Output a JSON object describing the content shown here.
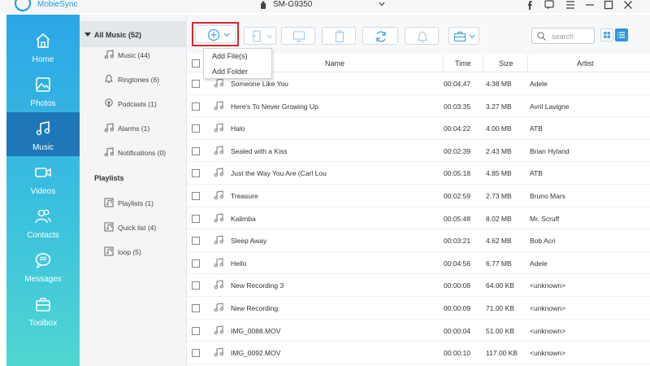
{
  "app": {
    "title": "MobieSync"
  },
  "device": {
    "name": "SM-G9350"
  },
  "colors": {
    "accent": "#1e9be0",
    "nav_active": "#1d77b8",
    "highlight": "#d9262a"
  },
  "nav": [
    {
      "label": "Home",
      "icon": "home-icon"
    },
    {
      "label": "Photos",
      "icon": "photo-icon"
    },
    {
      "label": "Music",
      "icon": "music-icon",
      "active": true
    },
    {
      "label": "Videos",
      "icon": "video-icon"
    },
    {
      "label": "Contacts",
      "icon": "contacts-icon"
    },
    {
      "label": "Messages",
      "icon": "messages-icon"
    },
    {
      "label": "Toolbox",
      "icon": "toolbox-icon"
    }
  ],
  "categories": {
    "header": "All Music (52)",
    "items": [
      {
        "label": "Music (44)",
        "icon": "music-note-icon"
      },
      {
        "label": "Ringtones (6)",
        "icon": "bell-icon"
      },
      {
        "label": "Podcasts (1)",
        "icon": "podcast-icon"
      },
      {
        "label": "Alarms (1)",
        "icon": "alarm-icon"
      },
      {
        "label": "Notifications (0)",
        "icon": "notification-icon"
      }
    ],
    "playlists_title": "Playlists",
    "playlists": [
      {
        "label": "Playlists (1)",
        "icon": "playlist-icon"
      },
      {
        "label": "Quick list (4)",
        "icon": "playlist-icon"
      },
      {
        "label": "loop (5)",
        "icon": "playlist-icon"
      }
    ]
  },
  "search": {
    "placeholder": "search"
  },
  "dropdown": {
    "items": [
      "Add File(s)",
      "Add Folder"
    ]
  },
  "table": {
    "columns": [
      "Name",
      "Time",
      "Size",
      "Artist"
    ],
    "rows": [
      {
        "name": "Someone Like You",
        "time": "00:04:47",
        "size": "4.38 MB",
        "artist": "Adele"
      },
      {
        "name": "Here's To Never Growing Up",
        "time": "00:03:35",
        "size": "3.27 MB",
        "artist": "Avril Lavigne"
      },
      {
        "name": "Halo",
        "time": "00:04:22",
        "size": "4.00 MB",
        "artist": "ATB"
      },
      {
        "name": "Sealed with a Kiss",
        "time": "00:02:39",
        "size": "2.43 MB",
        "artist": "Brian Hyland"
      },
      {
        "name": "Just the Way You Are (Carl Lou",
        "time": "00:05:18",
        "size": "4.85 MB",
        "artist": "ATB"
      },
      {
        "name": "Treasure",
        "time": "00:02:59",
        "size": "2.73 MB",
        "artist": "Bruno Mars"
      },
      {
        "name": "Kalimba",
        "time": "00:05:48",
        "size": "8.02 MB",
        "artist": "Mr. Scruff"
      },
      {
        "name": "Sleep Away",
        "time": "00:03:21",
        "size": "4.62 MB",
        "artist": "Bob Acri"
      },
      {
        "name": "Hello",
        "time": "00:04:56",
        "size": "6.77 MB",
        "artist": "Adele"
      },
      {
        "name": "New Recording 3",
        "time": "00:00:08",
        "size": "64.00 KB",
        "artist": "<unknown>"
      },
      {
        "name": "New Recording",
        "time": "00:00:09",
        "size": "71.00 KB",
        "artist": "<unknown>"
      },
      {
        "name": "IMG_0088.MOV",
        "time": "00:00:04",
        "size": "51.00 KB",
        "artist": "<unknown>"
      },
      {
        "name": "IMG_0092.MOV",
        "time": "00:00:10",
        "size": "117.00 KB",
        "artist": "<unknown>"
      }
    ]
  }
}
